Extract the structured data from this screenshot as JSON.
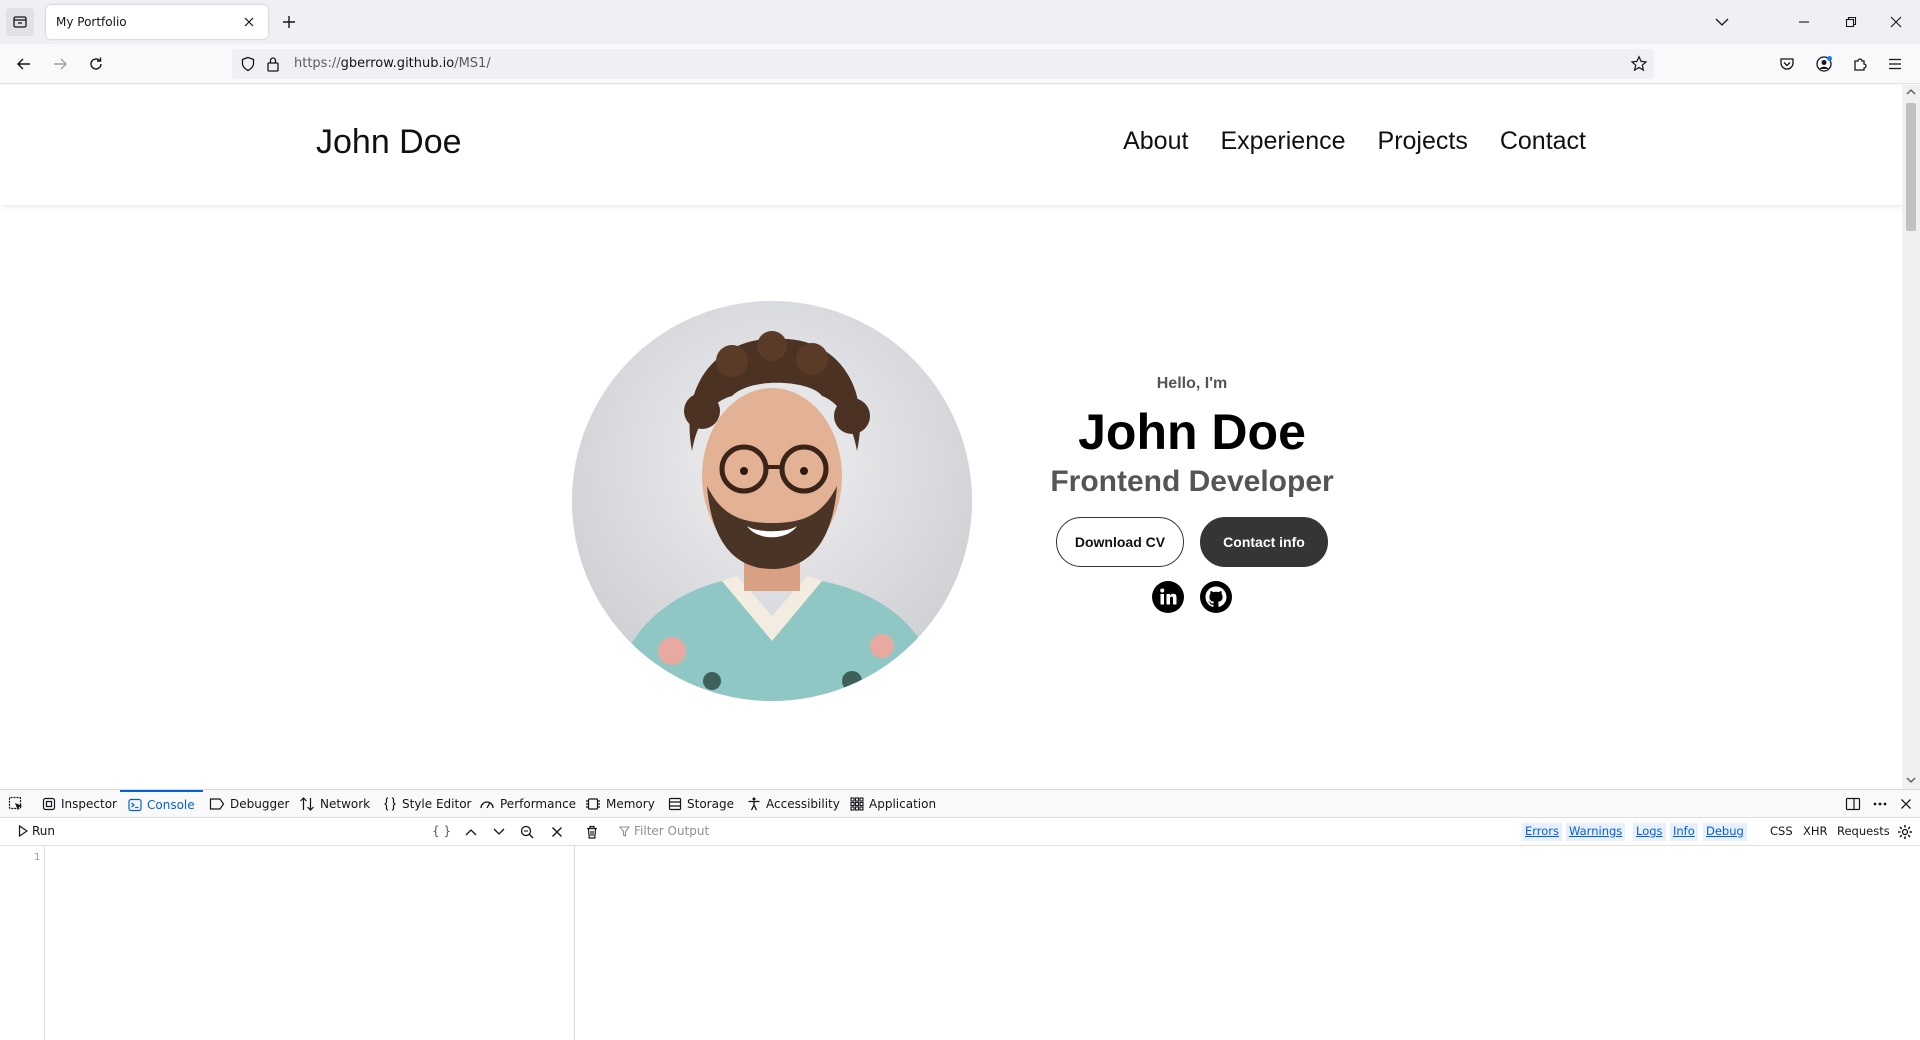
{
  "browser": {
    "tab_title": "My Portfolio",
    "url_scheme": "https://",
    "url_host": "gberrow.github.io",
    "url_path": "/MS1/"
  },
  "site": {
    "logo": "John Doe",
    "nav": [
      "About",
      "Experience",
      "Projects",
      "Contact"
    ],
    "hero": {
      "greeting": "Hello, I'm",
      "name": "John Doe",
      "role": "Frontend Developer",
      "download_cv": "Download CV",
      "contact_info": "Contact info"
    }
  },
  "devtools": {
    "tabs": [
      "Inspector",
      "Console",
      "Debugger",
      "Network",
      "Style Editor",
      "Performance",
      "Memory",
      "Storage",
      "Accessibility",
      "Application"
    ],
    "active_tab": "Console",
    "run_label": "Run",
    "braces_label": "{ }",
    "filter_placeholder": "Filter Output",
    "levels": [
      "Errors",
      "Warnings",
      "Logs",
      "Info",
      "Debug"
    ],
    "extra_filters": [
      "CSS",
      "XHR",
      "Requests"
    ],
    "line_number": "1"
  },
  "colors": {
    "accent": "#0061e0",
    "button_dark": "#353535"
  }
}
